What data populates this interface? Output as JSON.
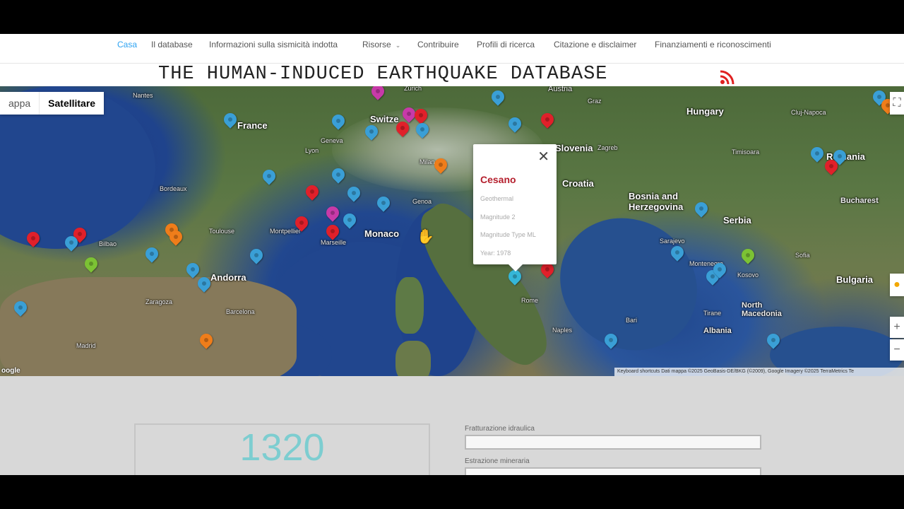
{
  "nav": {
    "items": [
      {
        "label": "Casa",
        "active": true
      },
      {
        "label": "Il database"
      },
      {
        "label": "Informazioni sulla sismicità indotta"
      },
      {
        "label": "Risorse",
        "dropdown": true
      },
      {
        "label": "Contribuire"
      },
      {
        "label": "Profili di ricerca"
      },
      {
        "label": "Citazione e disclaimer"
      },
      {
        "label": "Finanziamenti e riconoscimenti"
      }
    ]
  },
  "header": {
    "title": "THE HUMAN-INDUCED EARTHQUAKE DATABASE",
    "icon": "rss-icon"
  },
  "map": {
    "type_options": [
      "appa",
      "Satellitare"
    ],
    "selected_type": "Satellitare",
    "labels": {
      "country": [
        "France",
        "Switze",
        "Austria",
        "Hungary",
        "Slovenia",
        "Croatia",
        "Bosnia and Herzegovina",
        "Serbia",
        "Romania",
        "Monaco",
        "Andorra",
        "Kosovo",
        "Bulgaria",
        "North Macedonia",
        "Albania",
        "Montenegro"
      ],
      "city": [
        "Nantes",
        "Geneva",
        "Zurich",
        "Graz",
        "Zagreb",
        "Lyon",
        "Bordeaux",
        "Toulouse",
        "Montpellier",
        "Marseille",
        "Genoa",
        "Bilbao",
        "Zaragoza",
        "Barcelona",
        "Madrid",
        "Rome",
        "Naples",
        "Bari",
        "Sarajevo",
        "Sofia",
        "Bucharest",
        "Cluj-Napoca",
        "Timisoara",
        "Tirane",
        "Milan"
      ]
    },
    "popup": {
      "title": "Cesano",
      "type": "Geothermal",
      "magnitude": "Magnitude 2",
      "magnitude_type": "Magnitude Type ML",
      "year": "Year: 1978"
    },
    "pin_colors": {
      "blue": "#3a9fd6",
      "red": "#e0202a",
      "orange": "#ef7d1a",
      "magenta": "#c73aa8",
      "green": "#7cc234",
      "cyan": "#35b6d8"
    },
    "attribution": "Keyboard shortcuts   Dati mappa ©2025 GeoBasis-DE/BKG (©2009), Google Imagery ©2025 TerraMetrics   Te",
    "google_mark": "oogle"
  },
  "stats": {
    "count": "1320",
    "fields": [
      {
        "label": "Fratturazione idraulica",
        "value": ""
      },
      {
        "label": "Estrazione mineraria",
        "value": ""
      }
    ]
  },
  "colors": {
    "accent": "#2ea3f2",
    "popup_title": "#b5202e",
    "counter": "#7dcdd0"
  }
}
